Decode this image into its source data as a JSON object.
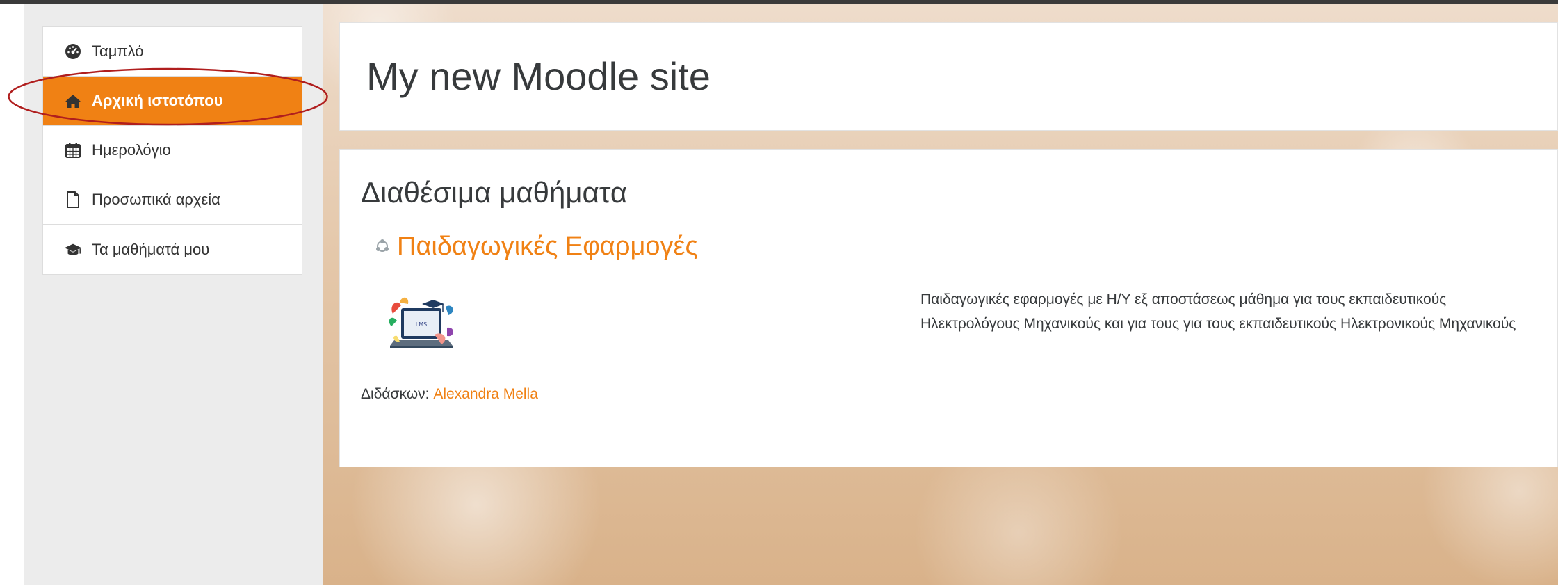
{
  "site": {
    "title": "My new Moodle site"
  },
  "nav": {
    "items": [
      {
        "label": "Ταμπλό",
        "icon": "dashboard-icon"
      },
      {
        "label": "Αρχική ιστοτόπου",
        "icon": "home-icon",
        "active": true
      },
      {
        "label": "Ημερολόγιο",
        "icon": "calendar-icon"
      },
      {
        "label": "Προσωπικά αρχεία",
        "icon": "file-icon"
      },
      {
        "label": "Τα μαθήματά μου",
        "icon": "graduation-cap-icon"
      }
    ]
  },
  "courses": {
    "heading": "Διαθέσιμα μαθήματα",
    "list": [
      {
        "name": "Παιδαγωγικές Εφαρμογές",
        "summary": "Παιδαγωγικές εφαρμογές με Η/Υ εξ αποστάσεως μάθημα για τους εκπαιδευτικούς Ηλεκτρολόγους Μηχανικούς και για τους για τους εκπαιδευτικούς Ηλεκτρονικούς Μηχανικούς",
        "teacher_label": "Διδάσκων:",
        "teacher_name": "Alexandra Mella",
        "image_label": "LMS"
      }
    ]
  },
  "colors": {
    "accent": "#f08114",
    "highlight": "#b01e1e",
    "text": "#373a3c"
  }
}
